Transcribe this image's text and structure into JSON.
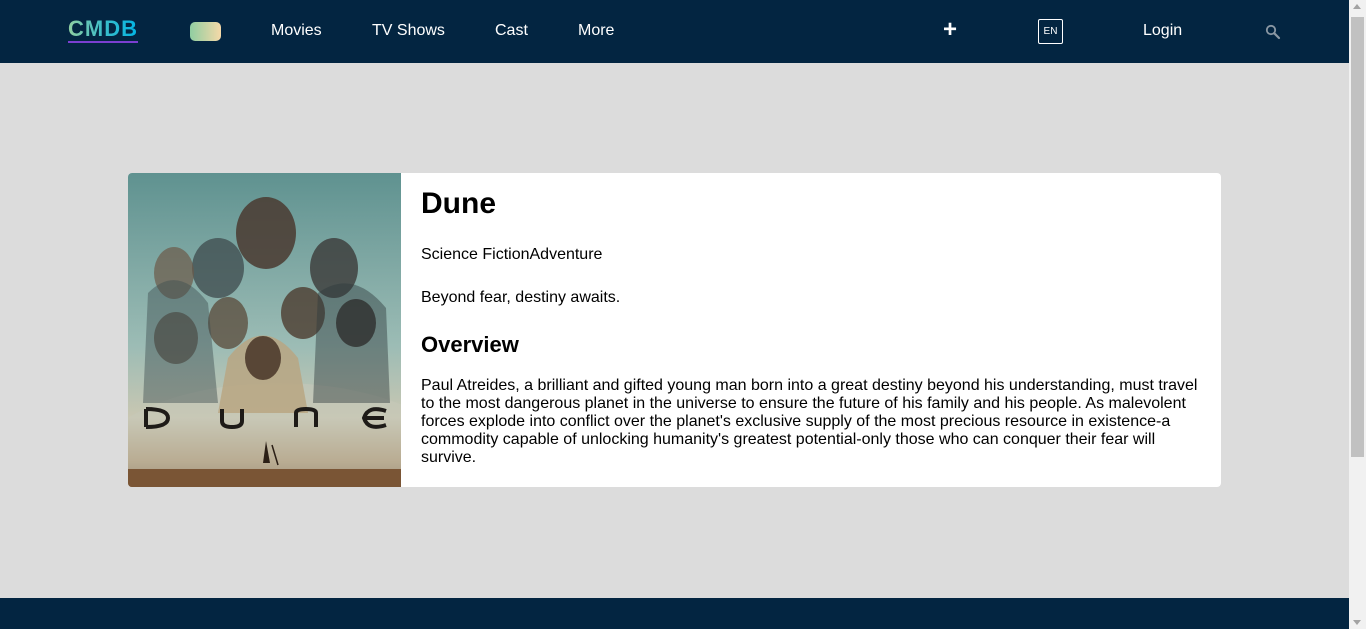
{
  "header": {
    "logo": "CMDB",
    "nav": [
      {
        "label": "Movies"
      },
      {
        "label": "TV Shows"
      },
      {
        "label": "Cast"
      },
      {
        "label": "More"
      }
    ],
    "add_label": "+",
    "language": "EN",
    "login_label": "Login",
    "search_icon": "search-icon"
  },
  "movie": {
    "title": "Dune",
    "genres": "Science FictionAdventure",
    "tagline": "Beyond fear, destiny awaits.",
    "overview_heading": "Overview",
    "overview": "Paul Atreides, a brilliant and gifted young man born into a great destiny beyond his understanding, must travel to the most dangerous planet in the universe to ensure the future of his family and his people. As malevolent forces explode into conflict over the planet's exclusive supply of the most precious resource in existence-a commodity capable of unlocking humanity's greatest potential-only those who can conquer their fear will survive.",
    "poster_text": "DUNE"
  },
  "colors": {
    "navbar": "#032541",
    "background": "#dcdcdc",
    "card": "#ffffff"
  }
}
